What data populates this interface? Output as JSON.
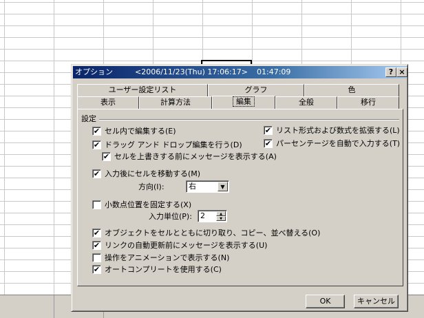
{
  "title_bar": {
    "title": "オプション",
    "datetime": "<2006/11/23(Thu) 17:06:17>",
    "elapsed": "01:47:09",
    "help_button": "?",
    "close_button": "×"
  },
  "tabs": {
    "row_top": [
      "ユーザー設定リスト",
      "グラフ",
      "色"
    ],
    "row_bottom": [
      "表示",
      "計算方法",
      "編集",
      "全般",
      "移行"
    ],
    "selected": "編集"
  },
  "settings": {
    "group_label": "設定",
    "edit_in_cell": {
      "label": "セル内で編集する(E)",
      "checked": true
    },
    "drag_drop": {
      "label": "ドラッグ アンド ドロップ編集を行う(D)",
      "checked": true
    },
    "alert_overwrite": {
      "label": "セルを上書きする前にメッセージを表示する(A)",
      "checked": true
    },
    "extend_list": {
      "label": "リスト形式および数式を拡張する(L)",
      "checked": true
    },
    "auto_percent": {
      "label": "パーセンテージを自動で入力する(T)",
      "checked": true
    },
    "move_after_enter": {
      "label": "入力後にセルを移動する(M)",
      "checked": true
    },
    "direction": {
      "label": "方向(I):",
      "value": "右"
    },
    "fixed_decimal": {
      "label": "小数点位置を固定する(X)",
      "checked": false
    },
    "places": {
      "label": "入力単位(P):",
      "value": "2"
    },
    "cut_copy_sort": {
      "label": "オブジェクトをセルとともに切り取り、コピー、並べ替える(O)",
      "checked": true
    },
    "ask_update_links": {
      "label": "リンクの自動更新前にメッセージを表示する(U)",
      "checked": true
    },
    "animate": {
      "label": "操作をアニメーションで表示する(N)",
      "checked": false
    },
    "autocomplete": {
      "label": "オートコンプリートを使用する(C)",
      "checked": true
    }
  },
  "buttons": {
    "ok": "OK",
    "cancel": "キャンセル"
  },
  "check_glyph": "✔"
}
